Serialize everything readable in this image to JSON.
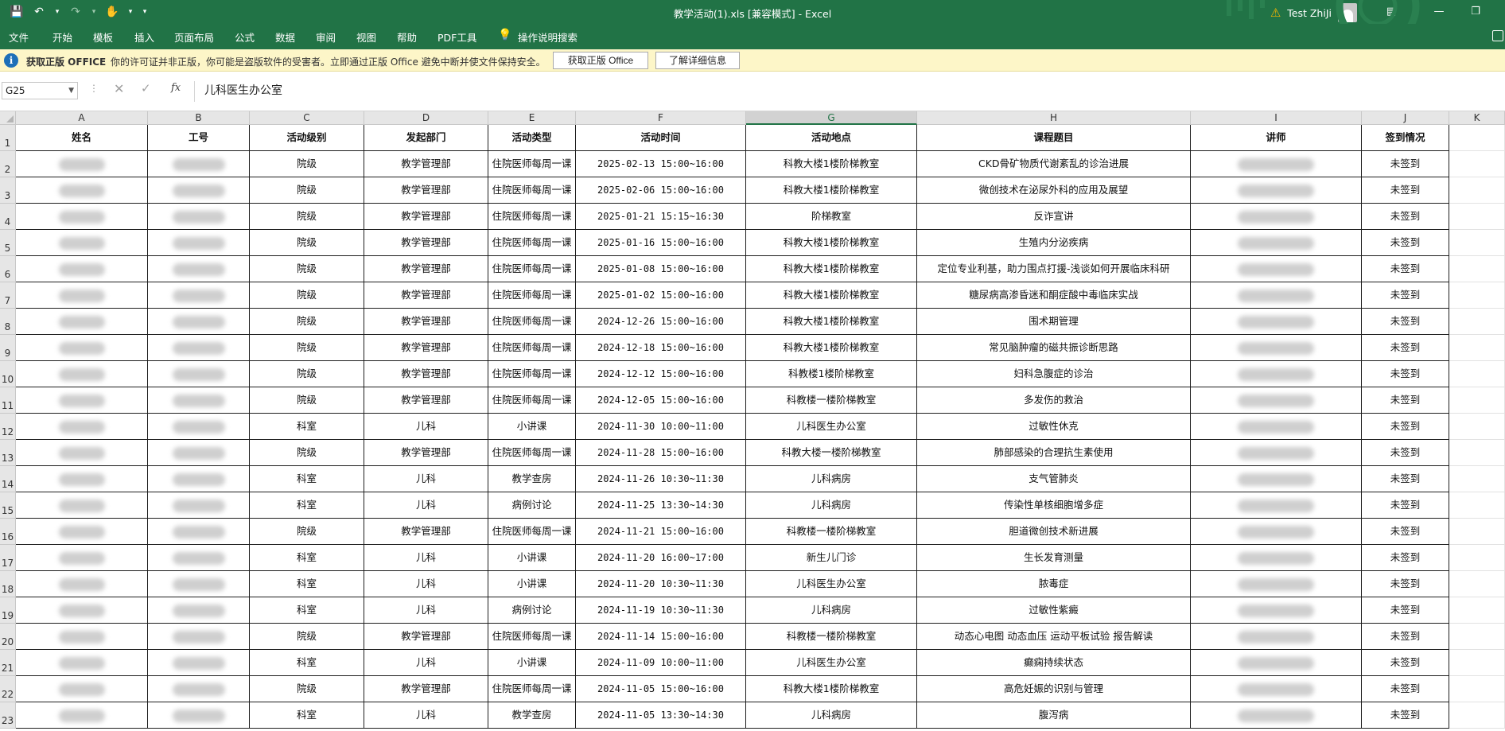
{
  "window": {
    "title": "教学活动(1).xls  [兼容模式]  -  Excel",
    "user": "Test ZhiJi",
    "brand_color": "#217346",
    "qa_icons": [
      "save-icon",
      "undo-icon",
      "redo-icon",
      "touch-mode-icon",
      "customize-icon"
    ],
    "warning_icon": "warning-icon"
  },
  "menu": {
    "tabs": [
      "文件",
      "开始",
      "模板",
      "插入",
      "页面布局",
      "公式",
      "数据",
      "审阅",
      "视图",
      "帮助",
      "PDF工具"
    ],
    "tell_me": "操作说明搜索"
  },
  "message_bar": {
    "heading": "获取正版 OFFICE",
    "text": "你的许可证并非正版，你可能是盗版软件的受害者。立即通过正版 Office 避免中断并使文件保持安全。",
    "button_get": "获取正版 Office",
    "button_learn": "了解详细信息"
  },
  "formula_bar": {
    "name_box": "G25",
    "fx": "fx",
    "value": "儿科医生办公室"
  },
  "sheet": {
    "selected_column": "G",
    "columns": [
      "A",
      "B",
      "C",
      "D",
      "E",
      "F",
      "G",
      "H",
      "I",
      "J",
      "K"
    ],
    "header": [
      "姓名",
      "工号",
      "活动级别",
      "发起部门",
      "活动类型",
      "活动时间",
      "活动地点",
      "课程题目",
      "讲师",
      "签到情况"
    ],
    "rows": [
      {
        "n": "2",
        "level": "院级",
        "dept": "教学管理部",
        "type": "住院医师每周一课",
        "time": "2025-02-13 15:00~16:00",
        "place": "科教大楼1楼阶梯教室",
        "topic": "CKD骨矿物质代谢紊乱的诊治进展",
        "status": "未签到"
      },
      {
        "n": "3",
        "level": "院级",
        "dept": "教学管理部",
        "type": "住院医师每周一课",
        "time": "2025-02-06 15:00~16:00",
        "place": "科教大楼1楼阶梯教室",
        "topic": "微创技术在泌尿外科的应用及展望",
        "status": "未签到"
      },
      {
        "n": "4",
        "level": "院级",
        "dept": "教学管理部",
        "type": "住院医师每周一课",
        "time": "2025-01-21 15:15~16:30",
        "place": "阶梯教室",
        "topic": "反诈宣讲",
        "status": "未签到"
      },
      {
        "n": "5",
        "level": "院级",
        "dept": "教学管理部",
        "type": "住院医师每周一课",
        "time": "2025-01-16 15:00~16:00",
        "place": "科教大楼1楼阶梯教室",
        "topic": "生殖内分泌疾病",
        "status": "未签到"
      },
      {
        "n": "6",
        "level": "院级",
        "dept": "教学管理部",
        "type": "住院医师每周一课",
        "time": "2025-01-08 15:00~16:00",
        "place": "科教大楼1楼阶梯教室",
        "topic": "定位专业利基，助力围点打援-浅谈如何开展临床科研",
        "status": "未签到"
      },
      {
        "n": "7",
        "level": "院级",
        "dept": "教学管理部",
        "type": "住院医师每周一课",
        "time": "2025-01-02 15:00~16:00",
        "place": "科教大楼1楼阶梯教室",
        "topic": "糖尿病高渗昏迷和酮症酸中毒临床实战",
        "status": "未签到"
      },
      {
        "n": "8",
        "level": "院级",
        "dept": "教学管理部",
        "type": "住院医师每周一课",
        "time": "2024-12-26 15:00~16:00",
        "place": "科教大楼1楼阶梯教室",
        "topic": "围术期管理",
        "status": "未签到"
      },
      {
        "n": "9",
        "level": "院级",
        "dept": "教学管理部",
        "type": "住院医师每周一课",
        "time": "2024-12-18 15:00~16:00",
        "place": "科教大楼1楼阶梯教室",
        "topic": "常见脑肿瘤的磁共振诊断思路",
        "status": "未签到"
      },
      {
        "n": "10",
        "level": "院级",
        "dept": "教学管理部",
        "type": "住院医师每周一课",
        "time": "2024-12-12 15:00~16:00",
        "place": "科教楼1楼阶梯教室",
        "topic": "妇科急腹症的诊治",
        "status": "未签到"
      },
      {
        "n": "11",
        "level": "院级",
        "dept": "教学管理部",
        "type": "住院医师每周一课",
        "time": "2024-12-05 15:00~16:00",
        "place": "科教楼一楼阶梯教室",
        "topic": "多发伤的救治",
        "status": "未签到"
      },
      {
        "n": "12",
        "level": "科室",
        "dept": "儿科",
        "type": "小讲课",
        "time": "2024-11-30 10:00~11:00",
        "place": "儿科医生办公室",
        "topic": "过敏性休克",
        "status": "未签到"
      },
      {
        "n": "13",
        "level": "院级",
        "dept": "教学管理部",
        "type": "住院医师每周一课",
        "time": "2024-11-28 15:00~16:00",
        "place": "科教大楼一楼阶梯教室",
        "topic": "肺部感染的合理抗生素使用",
        "status": "未签到"
      },
      {
        "n": "14",
        "level": "科室",
        "dept": "儿科",
        "type": "教学查房",
        "time": "2024-11-26 10:30~11:30",
        "place": "儿科病房",
        "topic": "支气管肺炎",
        "status": "未签到"
      },
      {
        "n": "15",
        "level": "科室",
        "dept": "儿科",
        "type": "病例讨论",
        "time": "2024-11-25 13:30~14:30",
        "place": "儿科病房",
        "topic": "传染性单核细胞增多症",
        "status": "未签到"
      },
      {
        "n": "16",
        "level": "院级",
        "dept": "教学管理部",
        "type": "住院医师每周一课",
        "time": "2024-11-21 15:00~16:00",
        "place": "科教楼一楼阶梯教室",
        "topic": "胆道微创技术新进展",
        "status": "未签到"
      },
      {
        "n": "17",
        "level": "科室",
        "dept": "儿科",
        "type": "小讲课",
        "time": "2024-11-20 16:00~17:00",
        "place": "新生儿门诊",
        "topic": "生长发育测量",
        "status": "未签到"
      },
      {
        "n": "18",
        "level": "科室",
        "dept": "儿科",
        "type": "小讲课",
        "time": "2024-11-20 10:30~11:30",
        "place": "儿科医生办公室",
        "topic": "脓毒症",
        "status": "未签到"
      },
      {
        "n": "19",
        "level": "科室",
        "dept": "儿科",
        "type": "病例讨论",
        "time": "2024-11-19 10:30~11:30",
        "place": "儿科病房",
        "topic": "过敏性紫癜",
        "status": "未签到"
      },
      {
        "n": "20",
        "level": "院级",
        "dept": "教学管理部",
        "type": "住院医师每周一课",
        "time": "2024-11-14 15:00~16:00",
        "place": "科教楼一楼阶梯教室",
        "topic": "动态心电图   动态血压   运动平板试验  报告解读",
        "status": "未签到"
      },
      {
        "n": "21",
        "level": "科室",
        "dept": "儿科",
        "type": "小讲课",
        "time": "2024-11-09 10:00~11:00",
        "place": "儿科医生办公室",
        "topic": "癫痫持续状态",
        "status": "未签到"
      },
      {
        "n": "22",
        "level": "院级",
        "dept": "教学管理部",
        "type": "住院医师每周一课",
        "time": "2024-11-05 15:00~16:00",
        "place": "科教大楼1楼阶梯教室",
        "topic": "高危妊娠的识别与管理",
        "status": "未签到"
      },
      {
        "n": "23",
        "level": "科室",
        "dept": "儿科",
        "type": "教学查房",
        "time": "2024-11-05 13:30~14:30",
        "place": "儿科病房",
        "topic": "腹泻病",
        "status": "未签到"
      }
    ]
  }
}
